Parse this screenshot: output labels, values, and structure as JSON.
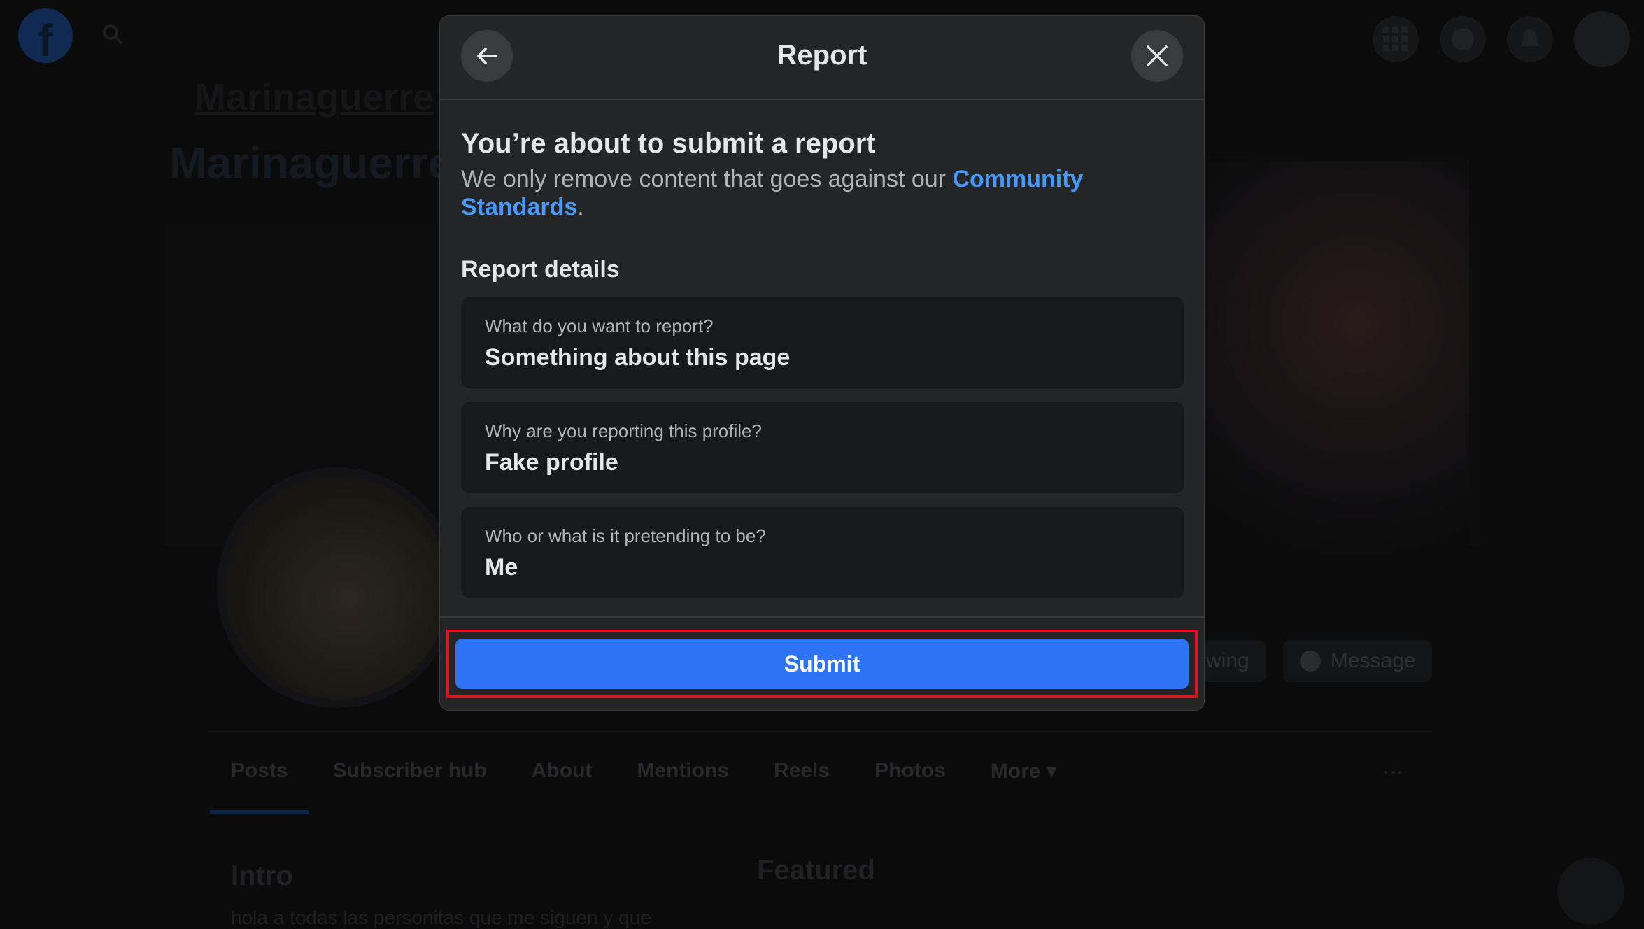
{
  "background": {
    "fb_logo_glyph": "f",
    "profile_name": "Marinaguerre",
    "action_buttons": [
      "wing",
      "Message"
    ],
    "tabs": [
      "Posts",
      "Subscriber hub",
      "About",
      "Mentions",
      "Reels",
      "Photos",
      "More ▾"
    ],
    "more_dots": "···",
    "intro_title": "Intro",
    "featured_title": "Featured",
    "intro_text": "hola a todas las personitas que me siguen y que"
  },
  "modal": {
    "title": "Report",
    "back_icon": "arrow-left-icon",
    "close_icon": "close-icon",
    "heading": "You’re about to submit a report",
    "description_prefix": "We only remove content that goes against our ",
    "description_link": "Community Standards",
    "description_suffix": ".",
    "details_title": "Report details",
    "details": [
      {
        "question": "What do you want to report?",
        "answer": "Something about this page"
      },
      {
        "question": "Why are you reporting this profile?",
        "answer": "Fake profile"
      },
      {
        "question": "Who or what is it pretending to be?",
        "answer": "Me"
      }
    ],
    "submit_label": "Submit"
  },
  "colors": {
    "accent": "#2d73f5",
    "link": "#4599ff",
    "highlight": "#e0141b",
    "modal_bg": "#242526"
  }
}
